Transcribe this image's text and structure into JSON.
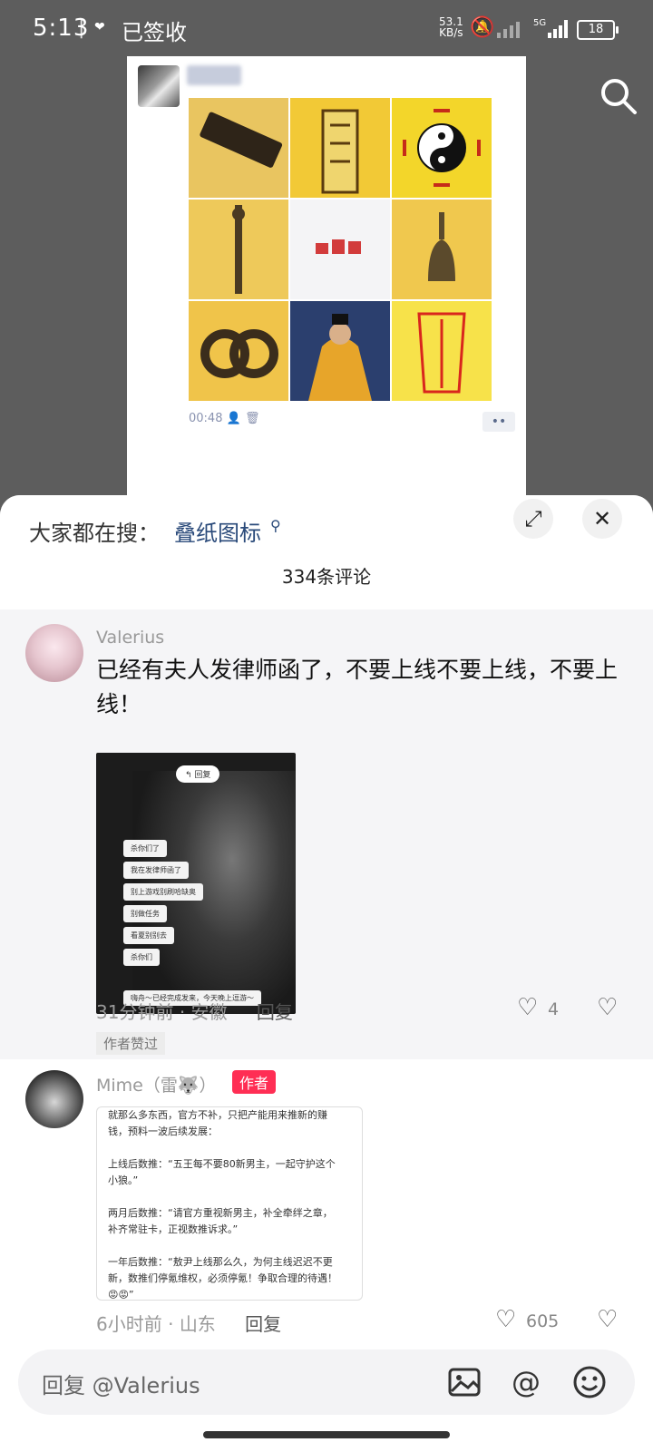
{
  "status_bar": {
    "time": "5:13",
    "app_label": "已签收",
    "net_speed_value": "53.1",
    "net_speed_unit": "KB/s",
    "battery": "18"
  },
  "post": {
    "time": "00:48",
    "more": "••"
  },
  "sheet": {
    "hot_search_label": "大家都在搜：",
    "hot_search_term": "叠纸图标",
    "comment_count": "334条评论",
    "expand_icon": "⤢",
    "close_icon": "✕"
  },
  "comments": [
    {
      "user": "Valerius",
      "text": "已经有夫人发律师函了，不要上线不要上线，不要上线！",
      "screenshot": {
        "reply_pill": "↰ 回复",
        "lines": [
          "杀你们了",
          "我在发律师函了",
          "别上游戏别刷哈缺奥",
          "别做任务",
          "看夏别别去",
          "杀你们"
        ],
        "footer": "嗨舟～已经完成发来，今天晚上逗游～"
      },
      "time": "31分钟前",
      "location": "安徽",
      "reply": "回复",
      "likes": "4",
      "badge": "作者赞过"
    },
    {
      "user": "Mime（雷🐺）",
      "author_badge": "作者",
      "note_lines": [
        "就那么多东西，官方不补，只把产能用来推新的赚",
        "钱，预料一波后续发展：",
        "",
        "上线后数推：“五王每不要80新男主，一起守护这个",
        "小狼。”",
        "",
        "两月后数推：“请官方重视新男主，补全牵绊之章，",
        "补齐常驻卡，正视数推诉求。”",
        "",
        "一年后数推：“敖尹上线那么久，为何主线迟迟不更",
        "新，数推们停氪维权，必须停氪！争取合理的待遇！",
        "😡😡”"
      ],
      "time": "6小时前",
      "location": "山东",
      "reply": "回复",
      "likes": "605"
    }
  ],
  "input": {
    "placeholder": "回复 @Valerius"
  },
  "icons": {
    "search": "search-icon",
    "image": "image-icon",
    "at": "@",
    "emoji": "emoji-icon"
  }
}
